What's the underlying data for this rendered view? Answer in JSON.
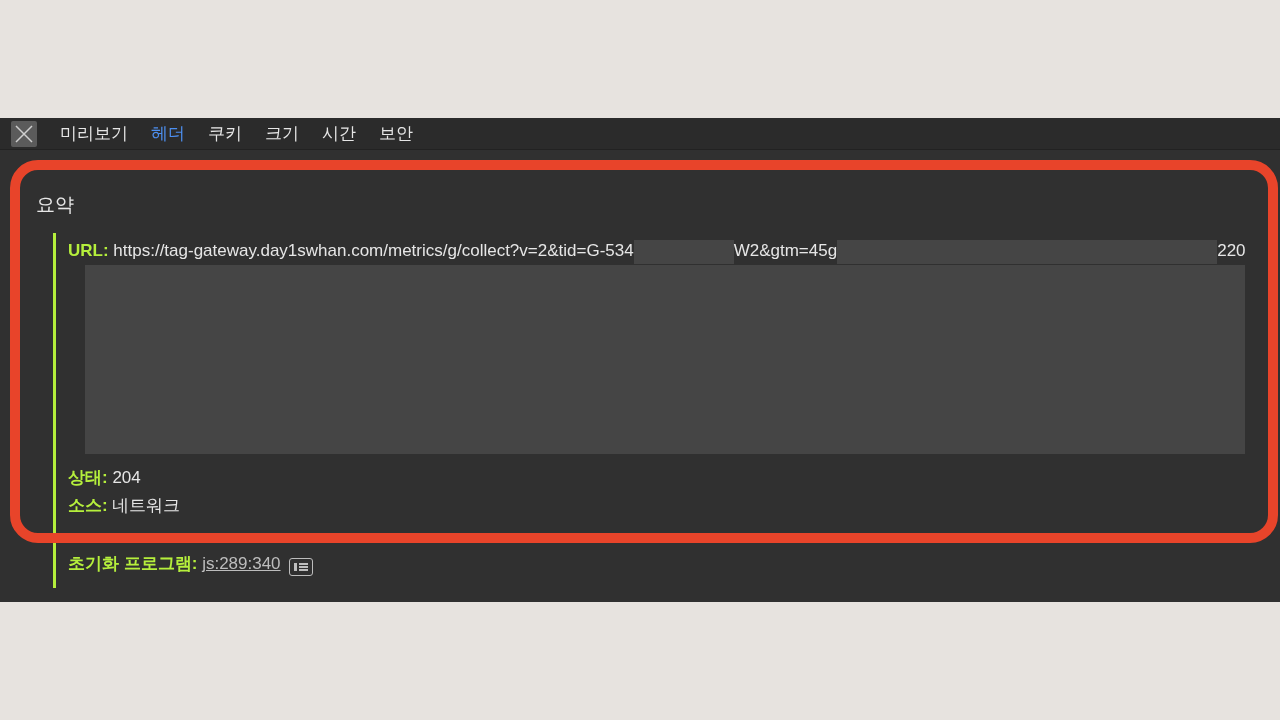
{
  "tabs": [
    {
      "label": "미리보기",
      "selected": false
    },
    {
      "label": "헤더",
      "selected": true
    },
    {
      "label": "쿠키",
      "selected": false
    },
    {
      "label": "크기",
      "selected": false
    },
    {
      "label": "시간",
      "selected": false
    },
    {
      "label": "보안",
      "selected": false
    }
  ],
  "section": {
    "title": "요약",
    "fields": [
      {
        "kind": "url",
        "label": "URL:",
        "parts": [
          "https://tag-gateway.day1swhan.com/metrics/g/collect?v=2&tid=G-534",
          "W2&gtm=45g",
          "220"
        ]
      },
      {
        "kind": "text",
        "label": "상태:",
        "value": "204"
      },
      {
        "kind": "text",
        "label": "소스:",
        "value": "네트워크"
      },
      {
        "kind": "link",
        "label": "초기화 프로그램:",
        "value": "js:289:340"
      }
    ]
  }
}
